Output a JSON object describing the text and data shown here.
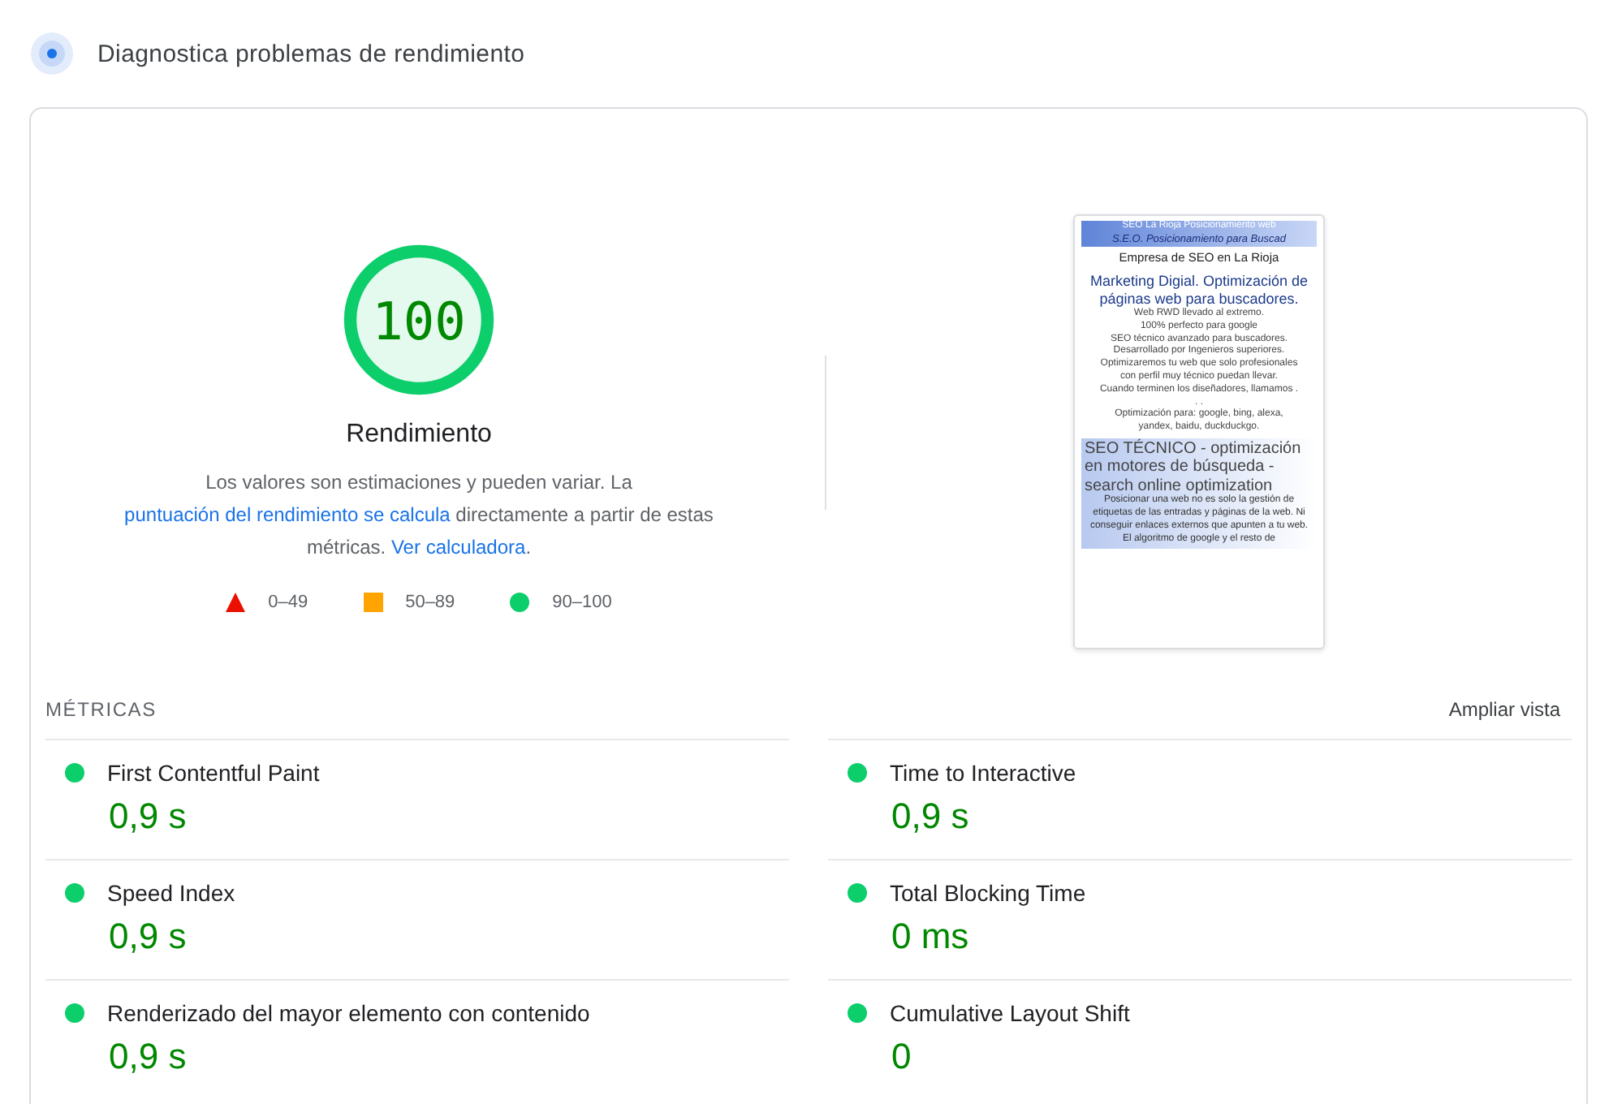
{
  "header": {
    "title": "Diagnostica problemas de rendimiento"
  },
  "score": {
    "value": "100",
    "level": 1.0,
    "color": "#0cce6b",
    "label": "Rendimiento"
  },
  "description": [
    {
      "text": "Los valores son estimaciones y pueden variar. La ",
      "link": false
    },
    {
      "text": "puntuación del rendimiento se calcula",
      "link": true
    },
    {
      "text": " directamente a partir de estas métricas. ",
      "link": false
    },
    {
      "text": "Ver calculadora",
      "link": true
    },
    {
      "text": ".",
      "link": false
    }
  ],
  "legend": [
    {
      "kind": "triangle",
      "range": "0–49"
    },
    {
      "kind": "square",
      "range": "50–89"
    },
    {
      "kind": "circle",
      "range": "90–100"
    }
  ],
  "screenshot": {
    "banner": [
      "SEO La Rioja Posicionamiento web",
      "S.E.O. Posicionamiento para Buscad"
    ],
    "subtitle": "Empresa de SEO en La Rioja",
    "headline": "Marketing Digial. Optimización de páginas web para buscadores.",
    "body": [
      "Web RWD llevado al extremo.",
      "100% perfecto para google",
      "SEO técnico avanzado para buscadores. Desarrollado por Ingenieros superiores.",
      "Optimizaremos tu web que solo profesionales con perfil muy técnico puedan llevar.",
      "Cuando terminen los diseñadores, llamamos . . .",
      "Optimización para: google, bing, alexa, yandex, baidu, duckduckgo."
    ],
    "section_title": "SEO TÉCNICO - optimización en motores de búsqueda - search online optimization",
    "section_text": "Posicionar una web no es solo la gestión de etiquetas de las entradas y páginas de la web. Ni conseguir enlaces externos que apunten a tu web. El algoritmo de google y el resto de"
  },
  "metrics_heading": "MÉTRICAS",
  "expand_link": "Ampliar vista",
  "metrics": [
    {
      "name": "First Contentful Paint",
      "value": "0,9 s",
      "color": "#0cce6b"
    },
    {
      "name": "Time to Interactive",
      "value": "0,9 s",
      "color": "#0cce6b"
    },
    {
      "name": "Speed Index",
      "value": "0,9 s",
      "color": "#0cce6b"
    },
    {
      "name": "Total Blocking Time",
      "value": "0 ms",
      "color": "#0cce6b"
    },
    {
      "name": "Renderizado del mayor elemento con contenido",
      "value": "0,9 s",
      "color": "#0cce6b"
    },
    {
      "name": "Cumulative Layout Shift",
      "value": "0",
      "color": "#0cce6b"
    }
  ]
}
